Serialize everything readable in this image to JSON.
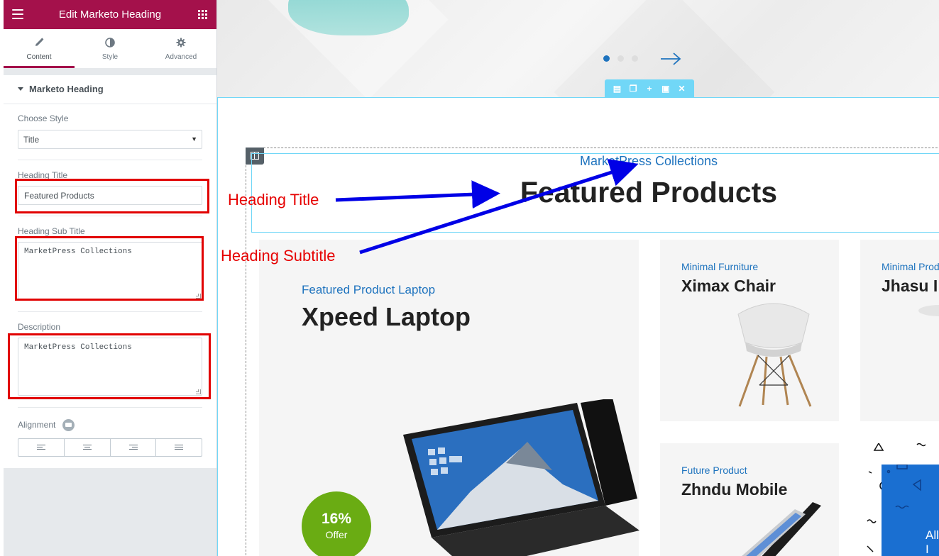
{
  "panel": {
    "title": "Edit Marketo Heading",
    "tabs": [
      {
        "label": "Content",
        "active": true
      },
      {
        "label": "Style",
        "active": false
      },
      {
        "label": "Advanced",
        "active": false
      }
    ],
    "section_title": "Marketo Heading",
    "choose_style_label": "Choose Style",
    "choose_style_value": "Title",
    "heading_title_label": "Heading Title",
    "heading_title_value": "Featured Products",
    "heading_subtitle_label": "Heading Sub Title",
    "heading_subtitle_value": "MarketPress Collections",
    "description_label": "Description",
    "description_value": "MarketPress Collections",
    "alignment_label": "Alignment",
    "alignment_options": [
      "left",
      "center",
      "right",
      "justify"
    ],
    "accent_color": "#a4114b"
  },
  "preview": {
    "slider_dots": [
      true,
      false,
      false
    ],
    "section_toolbar": [
      "column-layout-icon",
      "duplicate-icon",
      "add-icon",
      "save-icon",
      "close-icon"
    ],
    "heading": {
      "subtitle": "MarketPress Collections",
      "title": "Featured Products",
      "subtitle_color": "#1e73be"
    },
    "products": [
      {
        "subtitle": "Featured Product Laptop",
        "title": "Xpeed Laptop",
        "offer_percent": "16%",
        "offer_label": "Offer"
      },
      {
        "subtitle": "Minimal Furniture",
        "title": "Ximax Chair"
      },
      {
        "subtitle": "Minimal Prod",
        "title": "Jhasu I"
      },
      {
        "subtitle": "Future Product",
        "title": "Zhndu Mobile"
      }
    ],
    "promo_text": "All I"
  },
  "annotations": {
    "heading_title": "Heading Title",
    "heading_subtitle": "Heading Subtitle",
    "arrow_color": "#0000e6",
    "text_color": "#e60000"
  }
}
